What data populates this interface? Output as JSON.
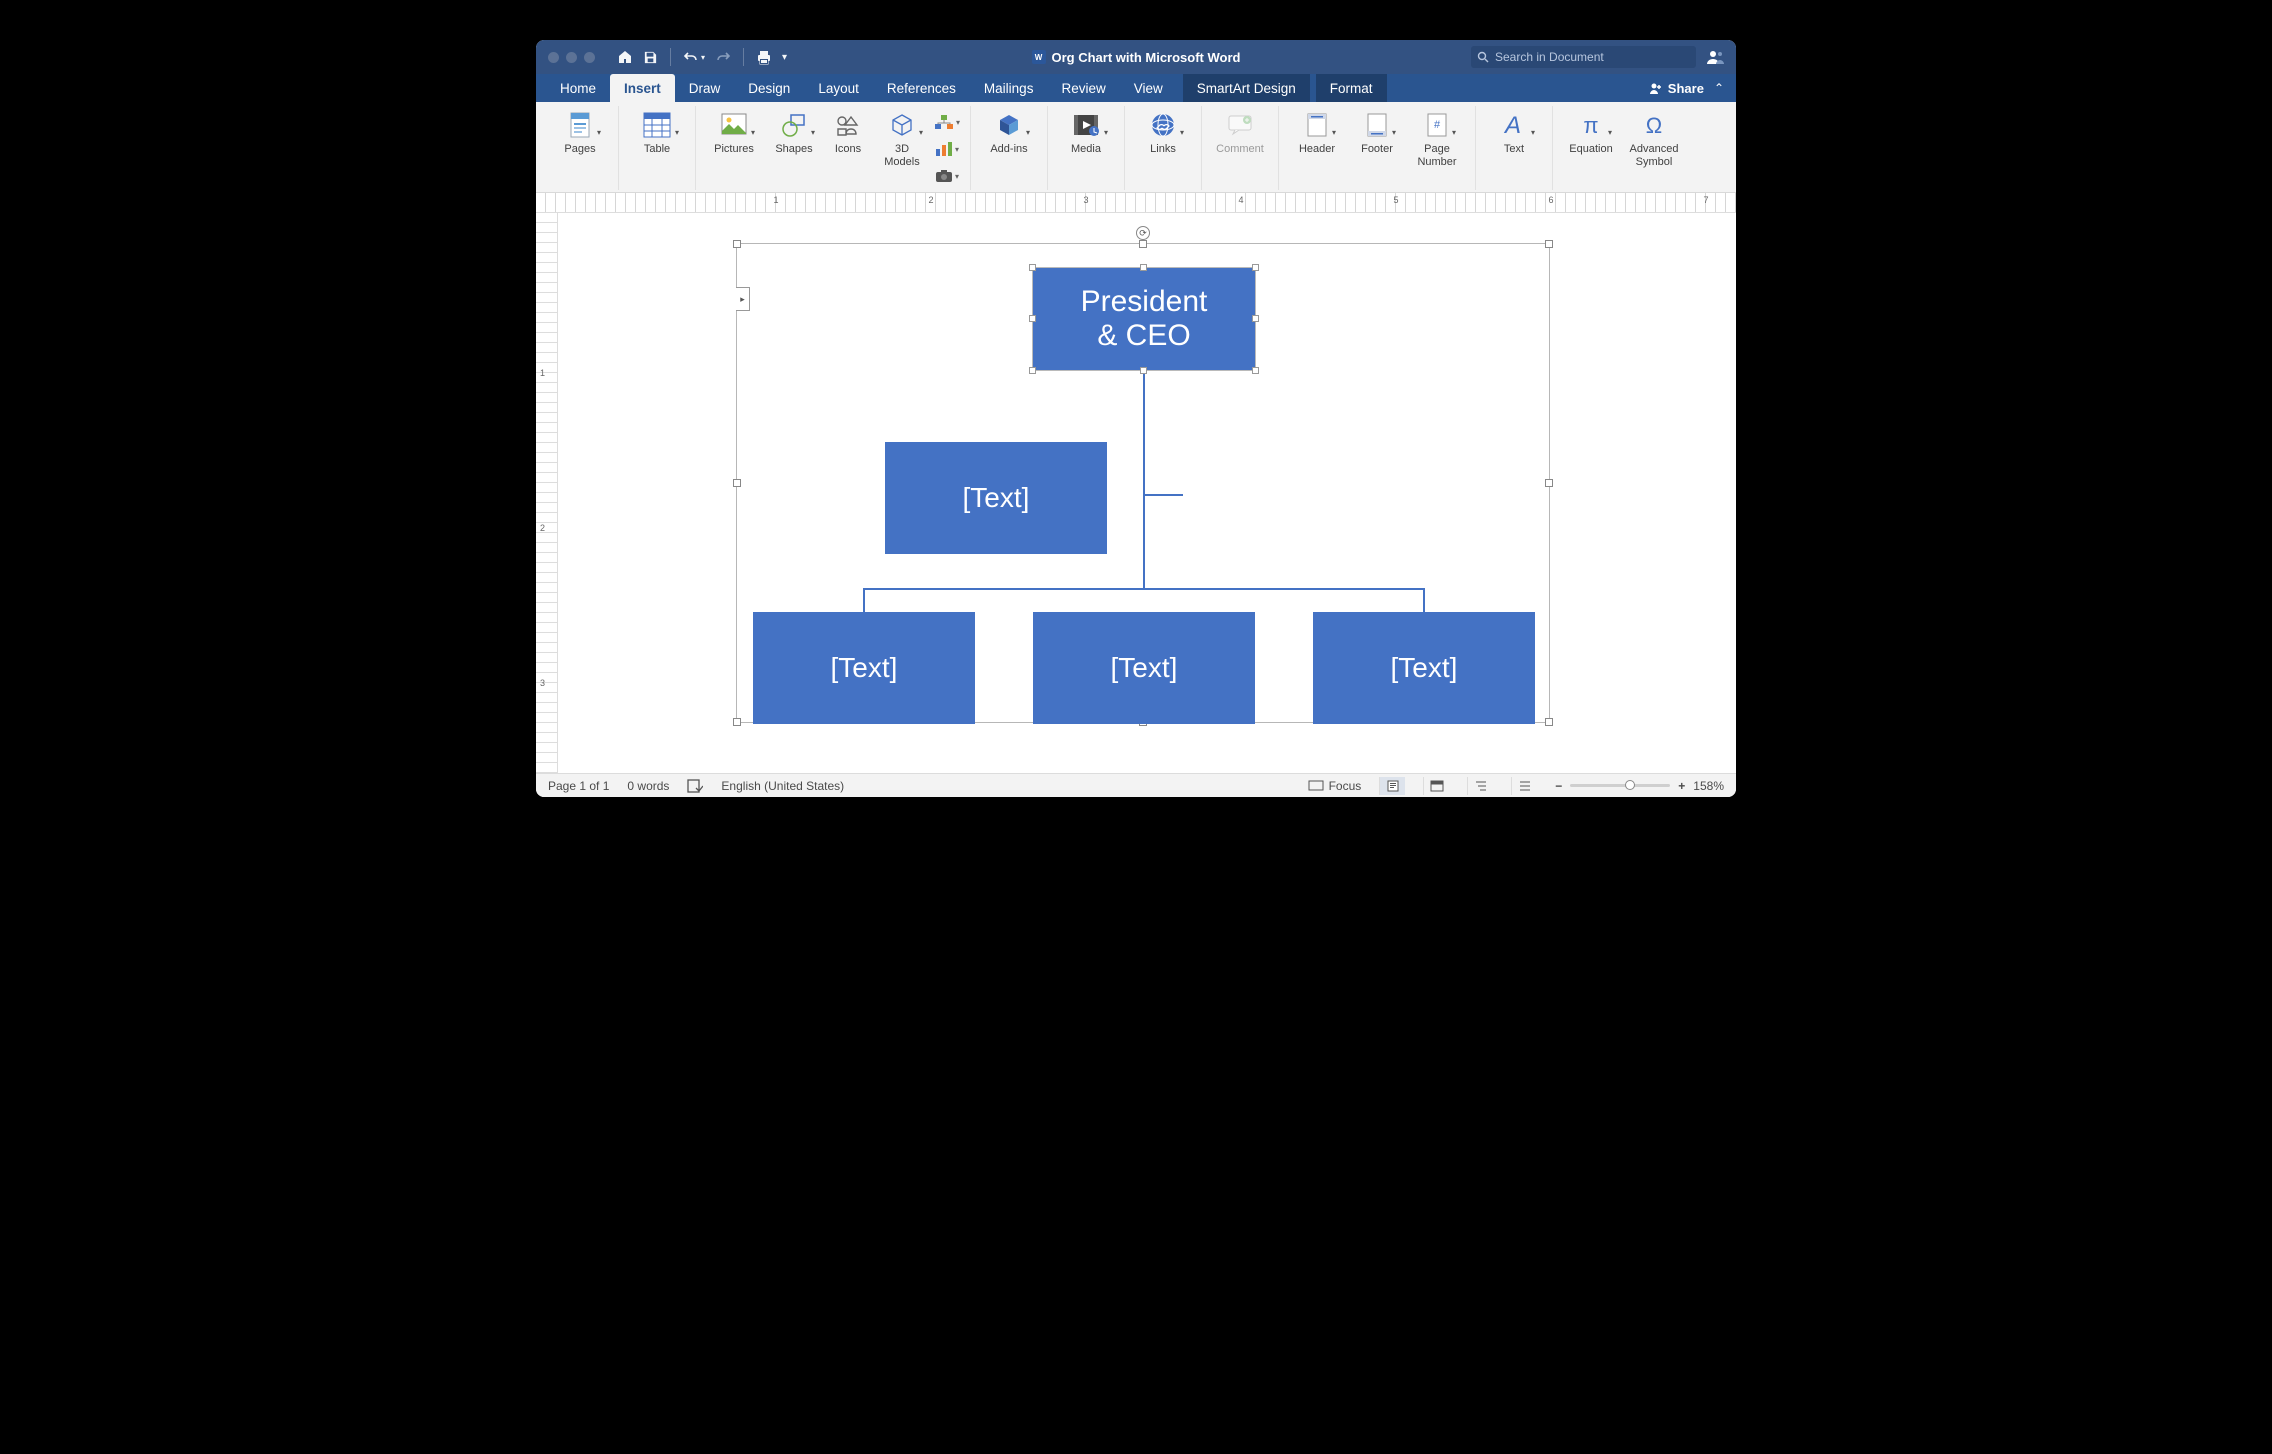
{
  "title": "Org Chart with Microsoft Word",
  "search_placeholder": "Search in Document",
  "tabs": {
    "home": "Home",
    "insert": "Insert",
    "draw": "Draw",
    "design": "Design",
    "layout": "Layout",
    "references": "References",
    "mailings": "Mailings",
    "review": "Review",
    "view": "View",
    "smartart": "SmartArt Design",
    "format": "Format"
  },
  "share": "Share",
  "ribbon": {
    "pages": "Pages",
    "table": "Table",
    "pictures": "Pictures",
    "shapes": "Shapes",
    "icons": "Icons",
    "models3d": "3D\nModels",
    "addins": "Add-ins",
    "media": "Media",
    "links": "Links",
    "comment": "Comment",
    "header": "Header",
    "footer": "Footer",
    "pagenumber": "Page\nNumber",
    "text": "Text",
    "equation": "Equation",
    "symbol": "Advanced\nSymbol"
  },
  "org": {
    "top": "President\n& CEO",
    "assistant": "[Text]",
    "child1": "[Text]",
    "child2": "[Text]",
    "child3": "[Text]"
  },
  "status": {
    "page": "Page 1 of 1",
    "words": "0 words",
    "lang": "English (United States)",
    "focus": "Focus",
    "zoom": "158%"
  },
  "ruler": {
    "h": [
      "1",
      "2",
      "3",
      "4",
      "5",
      "6",
      "7"
    ],
    "v": [
      "1",
      "2",
      "3"
    ]
  }
}
